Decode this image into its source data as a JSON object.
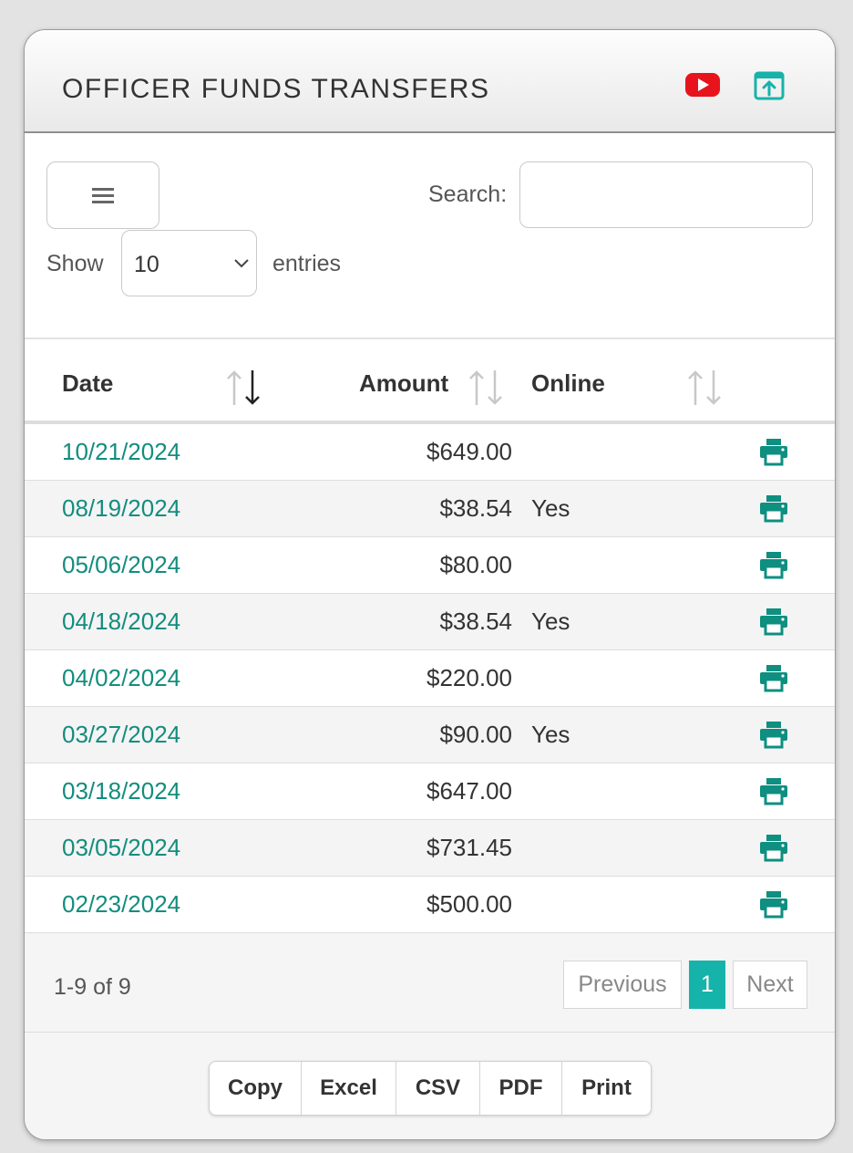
{
  "header": {
    "title": "OFFICER FUNDS TRANSFERS",
    "youtube_icon": "youtube-icon",
    "external_icon": "open-external-icon",
    "youtube_color": "#e8141c",
    "accent_color": "#16b3aa"
  },
  "controls": {
    "menu_icon": "hamburger-menu-icon",
    "search_label": "Search:",
    "search_value": "",
    "show_label": "Show",
    "entries_label": "entries",
    "length_selected": "10"
  },
  "table": {
    "columns": [
      "Date",
      "Amount",
      "Online"
    ],
    "sort_state": {
      "Date": "descending",
      "Amount": "none",
      "Online": "none"
    },
    "rows": [
      {
        "date": "10/21/2024",
        "amount": "$649.00",
        "online": ""
      },
      {
        "date": "08/19/2024",
        "amount": "$38.54",
        "online": "Yes"
      },
      {
        "date": "05/06/2024",
        "amount": "$80.00",
        "online": ""
      },
      {
        "date": "04/18/2024",
        "amount": "$38.54",
        "online": "Yes"
      },
      {
        "date": "04/02/2024",
        "amount": "$220.00",
        "online": ""
      },
      {
        "date": "03/27/2024",
        "amount": "$90.00",
        "online": "Yes"
      },
      {
        "date": "03/18/2024",
        "amount": "$647.00",
        "online": ""
      },
      {
        "date": "03/05/2024",
        "amount": "$731.45",
        "online": ""
      },
      {
        "date": "02/23/2024",
        "amount": "$500.00",
        "online": ""
      }
    ],
    "row_icon": "printer-icon"
  },
  "pagination": {
    "info": "1-9 of 9",
    "previous": "Previous",
    "current_page": "1",
    "next": "Next"
  },
  "export": {
    "buttons": [
      "Copy",
      "Excel",
      "CSV",
      "PDF",
      "Print"
    ]
  }
}
